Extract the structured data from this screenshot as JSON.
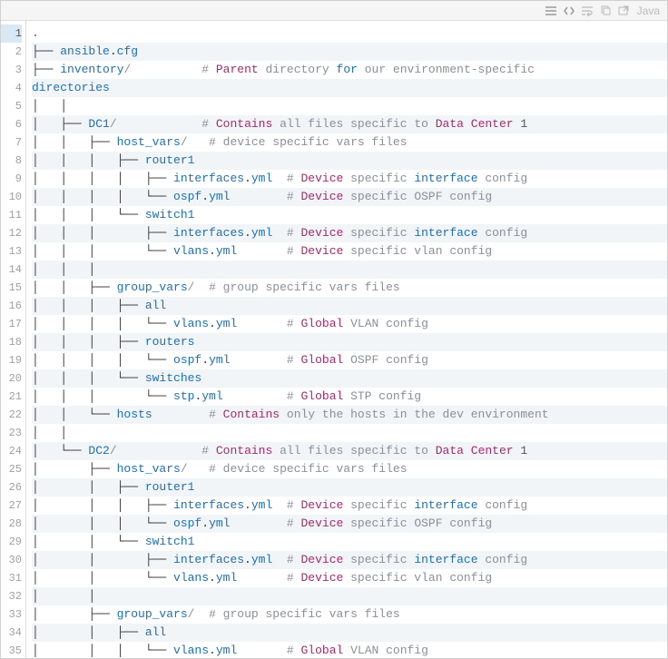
{
  "toolbar_label": "Java",
  "lines": [
    {
      "html": "<span class='n'>.</span>"
    },
    {
      "html": "├── <span class='k'>ansible</span>.<span class='k'>cfg</span>"
    },
    {
      "html": "├── <span class='k'>inventory</span><span class='c'>/</span>          <span class='c'># </span><span class='kw'>Parent</span><span class='c'> directory </span><span class='cw'>for</span><span class='c'> our environment-specific</span>"
    },
    {
      "html": "<span class='k'>directories</span>"
    },
    {
      "html": "│   │"
    },
    {
      "html": "│   ├── <span class='k'>DC1</span><span class='c'>/</span>            <span class='c'># </span><span class='kw'>Contains</span><span class='c'> all files specific to </span><span class='kw'>Data</span><span class='c'> </span><span class='kw'>Center</span><span class='c'> </span><span class='n'>1</span>"
    },
    {
      "html": "│   │   ├── <span class='k'>host_vars</span><span class='c'>/</span>   <span class='c'># device specific vars files</span>"
    },
    {
      "html": "│   │   │   ├── <span class='k'>router1</span>"
    },
    {
      "html": "│   │   │   │   ├── <span class='k'>interfaces</span>.<span class='k'>yml</span>  <span class='c'># </span><span class='kw'>Device</span><span class='c'> specific </span><span class='cw'>interface</span><span class='c'> config</span>"
    },
    {
      "html": "│   │   │   │   └── <span class='k'>ospf</span>.<span class='k'>yml</span>        <span class='c'># </span><span class='kw'>Device</span><span class='c'> specific OSPF config</span>"
    },
    {
      "html": "│   │   │   └── <span class='k'>switch1</span>"
    },
    {
      "html": "│   │   │       ├── <span class='k'>interfaces</span>.<span class='k'>yml</span>  <span class='c'># </span><span class='kw'>Device</span><span class='c'> specific </span><span class='cw'>interface</span><span class='c'> config</span>"
    },
    {
      "html": "│   │   │       └── <span class='k'>vlans</span>.<span class='k'>yml</span>       <span class='c'># </span><span class='kw'>Device</span><span class='c'> specific vlan config</span>"
    },
    {
      "html": "│   │   │"
    },
    {
      "html": "│   │   ├── <span class='k'>group_vars</span><span class='c'>/</span>  <span class='c'># group specific vars files</span>"
    },
    {
      "html": "│   │   │   ├── <span class='k'>all</span>"
    },
    {
      "html": "│   │   │   │   └── <span class='k'>vlans</span>.<span class='k'>yml</span>       <span class='c'># </span><span class='kw'>Global</span><span class='c'> VLAN config</span>"
    },
    {
      "html": "│   │   │   ├── <span class='k'>routers</span>"
    },
    {
      "html": "│   │   │   │   └── <span class='k'>ospf</span>.<span class='k'>yml</span>        <span class='c'># </span><span class='kw'>Global</span><span class='c'> OSPF config</span>"
    },
    {
      "html": "│   │   │   └── <span class='k'>switches</span>"
    },
    {
      "html": "│   │   │       └── <span class='k'>stp</span>.<span class='k'>yml</span>         <span class='c'># </span><span class='kw'>Global</span><span class='c'> STP config</span>"
    },
    {
      "html": "│   │   └── <span class='k'>hosts</span>        <span class='c'># </span><span class='kw'>Contains</span><span class='c'> only the hosts in the dev environment</span>"
    },
    {
      "html": "│   │"
    },
    {
      "html": "│   └── <span class='k'>DC2</span><span class='c'>/</span>            <span class='c'># </span><span class='kw'>Contains</span><span class='c'> all files specific to </span><span class='kw'>Data</span><span class='c'> </span><span class='kw'>Center</span><span class='c'> </span><span class='n'>1</span>"
    },
    {
      "html": "│       ├── <span class='k'>host_vars</span><span class='c'>/</span>   <span class='c'># device specific vars files</span>"
    },
    {
      "html": "│       │   ├── <span class='k'>router1</span>"
    },
    {
      "html": "│       │   │   ├── <span class='k'>interfaces</span>.<span class='k'>yml</span>  <span class='c'># </span><span class='kw'>Device</span><span class='c'> specific </span><span class='cw'>interface</span><span class='c'> config</span>"
    },
    {
      "html": "│       │   │   └── <span class='k'>ospf</span>.<span class='k'>yml</span>        <span class='c'># </span><span class='kw'>Device</span><span class='c'> specific OSPF config</span>"
    },
    {
      "html": "│       │   └── <span class='k'>switch1</span>"
    },
    {
      "html": "│       │       ├── <span class='k'>interfaces</span>.<span class='k'>yml</span>  <span class='c'># </span><span class='kw'>Device</span><span class='c'> specific </span><span class='cw'>interface</span><span class='c'> config</span>"
    },
    {
      "html": "│       │       └── <span class='k'>vlans</span>.<span class='k'>yml</span>       <span class='c'># </span><span class='kw'>Device</span><span class='c'> specific vlan config</span>"
    },
    {
      "html": "│       │"
    },
    {
      "html": "│       ├── <span class='k'>group_vars</span><span class='c'>/</span>  <span class='c'># group specific vars files</span>"
    },
    {
      "html": "│       │   ├── <span class='k'>all</span>"
    },
    {
      "html": "│       │   │   └── <span class='k'>vlans</span>.<span class='k'>yml</span>       <span class='c'># </span><span class='kw'>Global</span><span class='c'> VLAN config</span>"
    }
  ]
}
